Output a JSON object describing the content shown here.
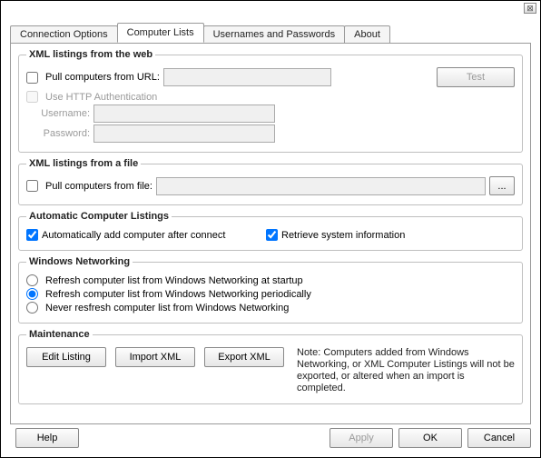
{
  "tabs": {
    "connection": "Connection Options",
    "computer_lists": "Computer Lists",
    "usernames": "Usernames and Passwords",
    "about": "About"
  },
  "xml_web": {
    "legend": "XML listings from the web",
    "pull_url_label": "Pull computers from URL:",
    "url_value": "",
    "test_label": "Test",
    "use_http_auth_label": "Use HTTP Authentication",
    "username_label": "Username:",
    "username_value": "",
    "password_label": "Password:",
    "password_value": ""
  },
  "xml_file": {
    "legend": "XML listings from a file",
    "pull_file_label": "Pull computers from file:",
    "file_value": "",
    "browse_label": "..."
  },
  "auto": {
    "legend": "Automatic Computer Listings",
    "auto_add_label": "Automatically add computer after connect",
    "retrieve_label": "Retrieve system information"
  },
  "winnet": {
    "legend": "Windows Networking",
    "opt_startup": "Refresh computer list from Windows Networking at startup",
    "opt_periodic": "Refresh computer list from Windows Networking periodically",
    "opt_never": "Never resfresh computer list from Windows Networking"
  },
  "maint": {
    "legend": "Maintenance",
    "edit_label": "Edit Listing",
    "import_label": "Import XML",
    "export_label": "Export XML",
    "note": "Note: Computers added from Windows Networking, or XML Computer Listings will not be exported, or altered when an import is completed."
  },
  "footer": {
    "help": "Help",
    "apply": "Apply",
    "ok": "OK",
    "cancel": "Cancel"
  }
}
